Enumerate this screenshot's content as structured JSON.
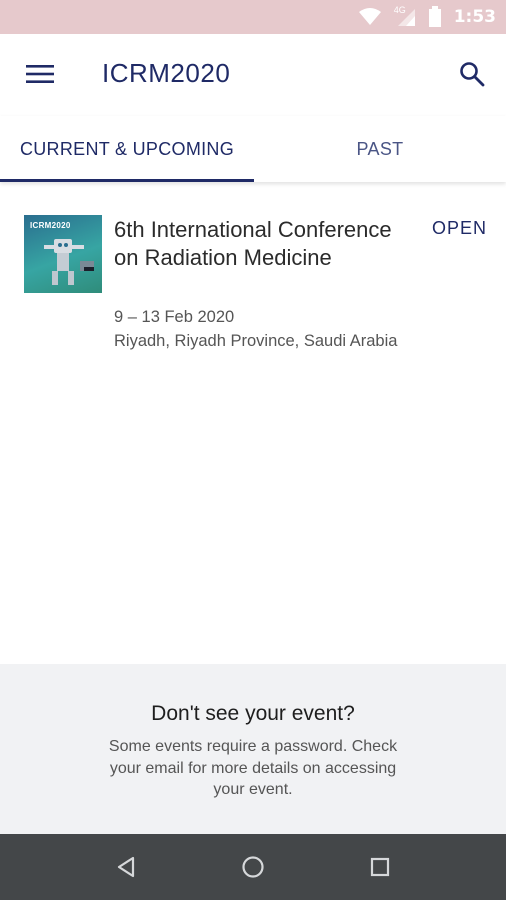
{
  "status_bar": {
    "time": "1:53",
    "network_label": "4G",
    "icons": [
      "wifi-icon",
      "cellular-signal-icon",
      "battery-icon"
    ]
  },
  "app_bar": {
    "title": "ICRM2020",
    "menu_icon": "hamburger-menu-icon",
    "search_icon": "search-icon"
  },
  "tabs": [
    {
      "label": "CURRENT & UPCOMING",
      "active": true
    },
    {
      "label": "PAST",
      "active": false
    }
  ],
  "events": [
    {
      "thumbnail_text": "ICRM2020",
      "title": "6th International Conference on Radiation Medicine",
      "status": "OPEN",
      "date": "9 – 13 Feb 2020",
      "location": "Riyadh, Riyadh Province, Saudi Arabia"
    }
  ],
  "footer": {
    "heading": "Don't see your event?",
    "body": "Some events require a password. Check your email for more details on accessing your event."
  },
  "nav_bar": {
    "icons": [
      "back-icon",
      "home-icon",
      "recent-apps-icon"
    ]
  },
  "colors": {
    "primary": "#1f2a66",
    "status_bar": "#e6c9cc",
    "nav_bar": "#444749",
    "footer_bg": "#f1f2f4"
  }
}
